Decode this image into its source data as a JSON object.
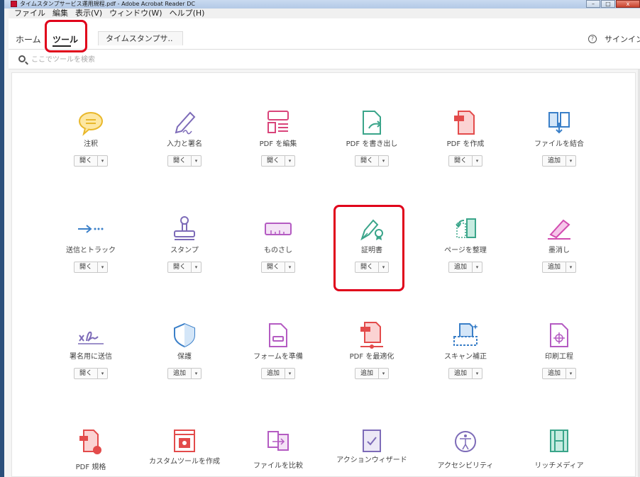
{
  "window": {
    "title": "タイムスタンプサービス運用規程.pdf - Adobe Acrobat Reader DC",
    "controls": {
      "min": "–",
      "max": "□",
      "close": "x"
    }
  },
  "menu": [
    "ファイル",
    "編集",
    "表示(V)",
    "ウィンドウ(W)",
    "ヘルプ(H)"
  ],
  "tabs": {
    "home": "ホーム",
    "tools": "ツール",
    "document": "タイムスタンプサ..",
    "signin": "サインイン",
    "help": "?"
  },
  "search": {
    "placeholder": "ここでツールを検索"
  },
  "colors": {
    "accent": "#e0001a",
    "window_frame": "#2b4f7a"
  },
  "tools": [
    {
      "label": "注釈",
      "button": "開く",
      "icon": "comment-icon"
    },
    {
      "label": "入力と署名",
      "button": "開く",
      "icon": "fill-sign-icon"
    },
    {
      "label": "PDF を編集",
      "button": "開く",
      "icon": "edit-pdf-icon"
    },
    {
      "label": "PDF を書き出し",
      "button": "開く",
      "icon": "export-pdf-icon"
    },
    {
      "label": "PDF を作成",
      "button": "開く",
      "icon": "create-pdf-icon"
    },
    {
      "label": "ファイルを結合",
      "button": "追加",
      "icon": "combine-files-icon"
    },
    {
      "label": "送信とトラック",
      "button": "開く",
      "icon": "send-track-icon"
    },
    {
      "label": "スタンプ",
      "button": "開く",
      "icon": "stamp-icon"
    },
    {
      "label": "ものさし",
      "button": "開く",
      "icon": "ruler-icon"
    },
    {
      "label": "証明書",
      "button": "開く",
      "icon": "certificate-icon"
    },
    {
      "label": "ページを整理",
      "button": "追加",
      "icon": "organize-pages-icon"
    },
    {
      "label": "墨消し",
      "button": "追加",
      "icon": "redact-icon"
    },
    {
      "label": "署名用に送信",
      "button": "開く",
      "icon": "send-for-signature-icon"
    },
    {
      "label": "保護",
      "button": "追加",
      "icon": "protect-icon"
    },
    {
      "label": "フォームを準備",
      "button": "追加",
      "icon": "prepare-form-icon"
    },
    {
      "label": "PDF を最適化",
      "button": "追加",
      "icon": "optimize-pdf-icon"
    },
    {
      "label": "スキャン補正",
      "button": "追加",
      "icon": "scan-enhance-icon"
    },
    {
      "label": "印刷工程",
      "button": "追加",
      "icon": "print-production-icon"
    },
    {
      "label": "PDF 規格",
      "icon": "pdf-standards-icon"
    },
    {
      "label": "カスタムツールを作成",
      "icon": "custom-tool-icon"
    },
    {
      "label": "ファイルを比較",
      "icon": "compare-files-icon"
    },
    {
      "label": "アクションウィザード",
      "icon": "action-wizard-icon"
    },
    {
      "label": "アクセシビリティ",
      "icon": "accessibility-icon"
    },
    {
      "label": "リッチメディア",
      "icon": "rich-media-icon"
    }
  ]
}
